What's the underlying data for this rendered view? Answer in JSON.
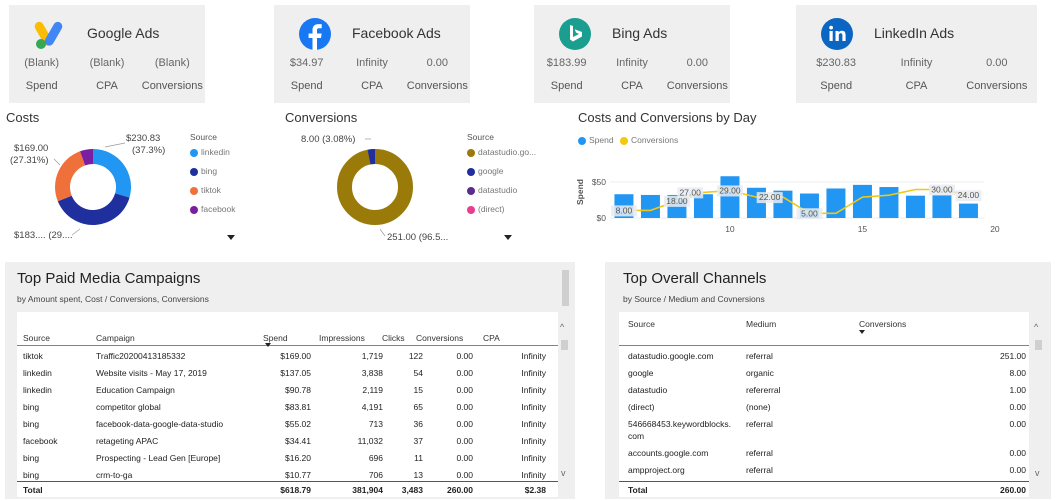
{
  "cards": [
    {
      "title": "Google Ads",
      "icon": "google-ads-icon",
      "values": [
        "(Blank)",
        "(Blank)",
        "(Blank)"
      ],
      "labels": [
        "Spend",
        "CPA",
        "Conversions"
      ]
    },
    {
      "title": "Facebook Ads",
      "icon": "facebook-icon",
      "values": [
        "$34.97",
        "Infinity",
        "0.00"
      ],
      "labels": [
        "Spend",
        "CPA",
        "Conversions"
      ]
    },
    {
      "title": "Bing Ads",
      "icon": "bing-icon",
      "values": [
        "$183.99",
        "Infinity",
        "0.00"
      ],
      "labels": [
        "Spend",
        "CPA",
        "Conversions"
      ]
    },
    {
      "title": "LinkedIn Ads",
      "icon": "linkedin-icon",
      "values": [
        "$230.83",
        "Infinity",
        "0.00"
      ],
      "labels": [
        "Spend",
        "CPA",
        "Conversions"
      ]
    }
  ],
  "costs": {
    "title": "Costs",
    "legend_title": "Source",
    "legend": [
      "linkedin",
      "bing",
      "tiktok",
      "facebook"
    ],
    "label_linkedin_1": "$230.83",
    "label_linkedin_2": "(37.3%)",
    "label_tiktok_1": "$169.00",
    "label_tiktok_2": "(27.31%)",
    "label_bing": "$183.... (29....",
    "colors": {
      "linkedin": "#2196f3",
      "bing": "#1f2f9e",
      "tiktok": "#f0703c",
      "facebook": "#7b1fa2"
    }
  },
  "conversions": {
    "title": "Conversions",
    "legend_title": "Source",
    "legend": [
      "datastudio.go...",
      "google",
      "datastudio",
      "(direct)"
    ],
    "label_top": "8.00 (3.08%)",
    "label_bottom": "251.00 (96.5...",
    "colors": {
      "datastudio_google": "#9a7b0a",
      "google": "#1f2f9e",
      "datastudio": "#5b2c8f",
      "direct": "#e83e8c"
    }
  },
  "by_day": {
    "title": "Costs and Conversions by Day",
    "legend": [
      "Spend",
      "Conversions"
    ],
    "colors": {
      "spend": "#2196f3",
      "conversions": "#f2c811"
    }
  },
  "chart_data": {
    "type": "bar",
    "title": "Costs and Conversions by Day",
    "ylabel": "Spend",
    "x_ticks": [
      "10",
      "15",
      "20"
    ],
    "y_ticks": [
      "$50",
      "$0"
    ],
    "x": [
      6,
      7,
      8,
      9,
      10,
      11,
      12,
      13,
      14,
      15,
      16,
      17,
      18,
      19
    ],
    "series": [
      {
        "name": "Spend",
        "values": [
          33,
          32,
          32,
          33,
          58,
          42,
          38,
          34,
          41,
          46,
          43,
          31,
          32,
          20
        ]
      },
      {
        "name": "Conversions",
        "values": [
          8,
          8,
          18,
          27,
          29,
          22,
          22,
          5,
          5,
          22,
          24,
          30,
          30,
          24
        ]
      }
    ],
    "data_labels": [
      {
        "x": 6,
        "text": "8.00"
      },
      {
        "x": 8,
        "text": "18.00"
      },
      {
        "x": 8.5,
        "text": "27.00"
      },
      {
        "x": 10,
        "text": "29.00"
      },
      {
        "x": 11.5,
        "text": "22.00"
      },
      {
        "x": 13,
        "text": "5.00"
      },
      {
        "x": 18,
        "text": "30.00"
      },
      {
        "x": 19,
        "text": "24.00"
      }
    ],
    "ylim": [
      0,
      60
    ]
  },
  "campaigns": {
    "title": "Top Paid Media Campaigns",
    "subtitle": "by Amount spent, Cost / Conversions, Conversions",
    "headers": [
      "Source",
      "Campaign",
      "Spend",
      "Impressions",
      "Clicks",
      "Conversions",
      "CPA"
    ],
    "rows": [
      [
        "tiktok",
        "Traffic20200413185332",
        "$169.00",
        "1,719",
        "122",
        "0.00",
        "Infinity"
      ],
      [
        "linkedin",
        "Website visits - May 17, 2019",
        "$137.05",
        "3,838",
        "54",
        "0.00",
        "Infinity"
      ],
      [
        "linkedin",
        "Education Campaign",
        "$90.78",
        "2,119",
        "15",
        "0.00",
        "Infinity"
      ],
      [
        "bing",
        "competitor global",
        "$83.81",
        "4,191",
        "65",
        "0.00",
        "Infinity"
      ],
      [
        "bing",
        "facebook-data-google-data-studio",
        "$55.02",
        "713",
        "36",
        "0.00",
        "Infinity"
      ],
      [
        "facebook",
        "retageting APAC",
        "$34.41",
        "11,032",
        "37",
        "0.00",
        "Infinity"
      ],
      [
        "bing",
        "Prospecting - Lead Gen [Europe]",
        "$16.20",
        "696",
        "11",
        "0.00",
        "Infinity"
      ],
      [
        "bing",
        "crm-to-ga",
        "$10.77",
        "706",
        "13",
        "0.00",
        "Infinity"
      ]
    ],
    "total": [
      "Total",
      "$618.79",
      "381,904",
      "3,483",
      "260.00",
      "$2.38"
    ]
  },
  "channels": {
    "title": "Top Overall Channels",
    "subtitle": "by Source / Medium and Covnersions",
    "headers": [
      "Source",
      "Medium",
      "Conversions"
    ],
    "rows": [
      [
        "datastudio.google.com",
        "referral",
        "251.00"
      ],
      [
        "google",
        "organic",
        "8.00"
      ],
      [
        "datastudio",
        "refererral",
        "1.00"
      ],
      [
        "(direct)",
        "(none)",
        "0.00"
      ],
      [
        "546668453.keywordblocks.",
        "referral",
        "0.00"
      ],
      [
        "com",
        "",
        ""
      ],
      [
        "accounts.google.com",
        "referral",
        "0.00"
      ],
      [
        "ampproject.org",
        "referral",
        "0.00"
      ]
    ],
    "total": [
      "Total",
      "260.00"
    ]
  }
}
